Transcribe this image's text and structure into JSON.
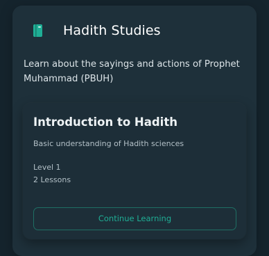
{
  "colors": {
    "page_background": "#15242d",
    "card_background": "#1e303a",
    "accent": "#1fae95",
    "button_border": "#1f6f64"
  },
  "header": {
    "icon": "book-icon",
    "title": "Hadith Studies"
  },
  "description": "Learn about the sayings and actions of Prophet Muhammad (PBUH)",
  "course": {
    "title": "Introduction to Hadith",
    "subtitle": "Basic understanding of Hadith sciences",
    "level": "Level 1",
    "lessons": "2 Lessons",
    "button_label": "Continue Learning"
  }
}
